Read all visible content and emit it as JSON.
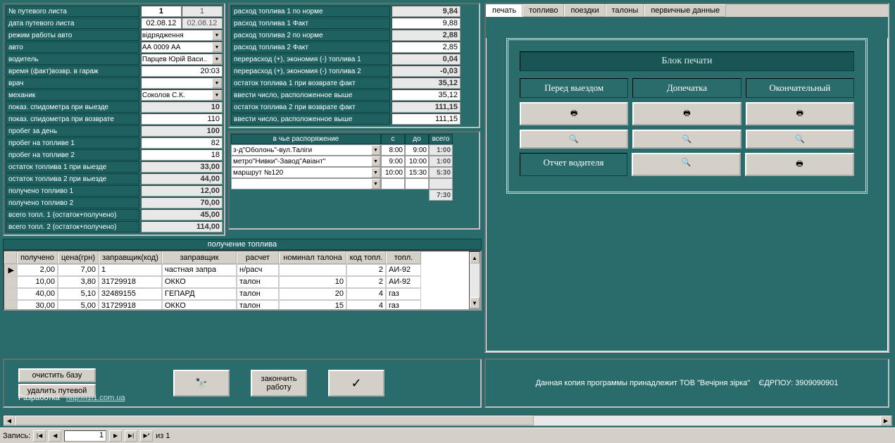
{
  "left_panel": {
    "labels": {
      "waybill_no": "№ путевого листа",
      "waybill_date": "дата путевого листа",
      "work_mode": "режим работы авто",
      "auto": "авто",
      "driver": "водитель",
      "return_time": "время (факт)возвр. в гараж",
      "doctor": "врач",
      "mechanic": "механик",
      "odo_out": "показ. спидометра при выезде",
      "odo_in": "показ. спидометра при возврате",
      "run_day": "пробег за день",
      "run_fuel1": "пробег на топливе 1",
      "run_fuel2": "пробег на топливе 2",
      "rest1_out": "остаток топлива 1 при выезде",
      "rest2_out": "остаток топлива 2 при выезде",
      "recv1": "получено топливо 1",
      "recv2": "получено топливо 2",
      "total1": "всего топл. 1 (остаток+получено)",
      "total2": "всего топл. 2 (остаток+получено)"
    },
    "values": {
      "waybill_no_a": "1",
      "waybill_no_b": "1",
      "date_a": "02.08.12",
      "date_b": "02.08.12",
      "work_mode": "відрядження",
      "auto": "АА 0009 АА",
      "driver": "Парцев Юрій Васи..",
      "return_time": "20:03",
      "doctor": "",
      "mechanic": "Соколов С.К.",
      "odo_out": "10",
      "odo_in": "110",
      "run_day": "100",
      "run_fuel1": "82",
      "run_fuel2": "18",
      "rest1_out": "33,00",
      "rest2_out": "44,00",
      "recv1": "12,00",
      "recv2": "70,00",
      "total1": "45,00",
      "total2": "114,00"
    }
  },
  "mid_panel": {
    "labels": {
      "cons1_norm": "расход топлива 1 по норме",
      "cons1_fact": "расход топлива 1 Факт",
      "cons2_norm": "расход топлива 2 по норме",
      "cons2_fact": "расход топлива 2 Факт",
      "over1": "перерасход (+), экономия (-) топлива 1",
      "over2": "перерасход (+), экономия (-) топлива 2",
      "rest1_in": "остаток топлива 1 при возврате факт",
      "enter1": "ввести число, расположенное выше",
      "rest2_in": "остаток топлива 2 при возврате факт",
      "enter2": "ввести число, расположенное выше"
    },
    "values": {
      "cons1_norm": "9,84",
      "cons1_fact": "9,88",
      "cons2_norm": "2,88",
      "cons2_fact": "2,85",
      "over1": "0,04",
      "over2": "-0,03",
      "rest1_in": "35,12",
      "enter1": "35,12",
      "rest2_in": "111,15",
      "enter2": "111,15"
    }
  },
  "routes": {
    "header": {
      "dispose": "в чье распоряжение",
      "from": "с",
      "to": "до",
      "total": "всего"
    },
    "rows": [
      {
        "dest": "з-д\"Оболонь\"-вул.Таліги",
        "from": "8:00",
        "to": "9:00",
        "total": "1:00"
      },
      {
        "dest": "метро\"Нивки\"-Завод\"Авіант\"",
        "from": "9:00",
        "to": "10:00",
        "total": "1:00"
      },
      {
        "dest": "маршрут №120",
        "from": "10:00",
        "to": "15:30",
        "total": "5:30"
      },
      {
        "dest": "",
        "from": "",
        "to": "",
        "total": ""
      }
    ],
    "grand_total": "7:30"
  },
  "fuel_receipt": {
    "title": "получение топлива",
    "cols": {
      "recv": "получено",
      "price": "цена(грн)",
      "code": "заправщик(код)",
      "name": "заправщик",
      "calc": "расчет",
      "nominal": "номинал талона",
      "fcode": "код топл.",
      "fuel": "топл."
    },
    "rows": [
      {
        "recv": "2,00",
        "price": "7,00",
        "code": "1",
        "name": "частная запра",
        "calc": "н/расч",
        "nominal": "",
        "fcode": "2",
        "fuel": "АИ-92"
      },
      {
        "recv": "10,00",
        "price": "3,80",
        "code": "31729918",
        "name": "ОККО",
        "calc": "талон",
        "nominal": "10",
        "fcode": "2",
        "fuel": "АИ-92"
      },
      {
        "recv": "40,00",
        "price": "5,10",
        "code": "32489155",
        "name": "ГЕПАРД",
        "calc": "талон",
        "nominal": "20",
        "fcode": "4",
        "fuel": "газ"
      },
      {
        "recv": "30,00",
        "price": "5,00",
        "code": "31729918",
        "name": "ОККО",
        "calc": "талон",
        "nominal": "15",
        "fcode": "4",
        "fuel": "газ"
      }
    ]
  },
  "tabs": {
    "t1": "печать",
    "t2": "топливо",
    "t3": "поездки",
    "t4": "талоны",
    "t5": "первичные данные"
  },
  "print": {
    "title": "Блок печати",
    "col1": "Перед выездом",
    "col2": "Допечатка",
    "col3": "Окончательный",
    "driver_report": "Отчет водителя"
  },
  "bottom": {
    "clear_base": "очистить базу",
    "delete_waybill": "удалить путевой",
    "finish1": "закончить",
    "finish2": "работу",
    "dev": "Разработка",
    "url": "http://l1l1.com.ua",
    "copy_txt": "Данная копия программы принадлежит ТОВ \"Вечірня зірка\"",
    "edrpou_label": "ЄДРПОУ:",
    "edrpou": "3909090901"
  },
  "status": {
    "record": "Запись:",
    "num": "1",
    "of": "из  1"
  },
  "icons": {
    "printer": "🖶",
    "search": "🔍",
    "binoc": "🔭",
    "check": "✓"
  }
}
